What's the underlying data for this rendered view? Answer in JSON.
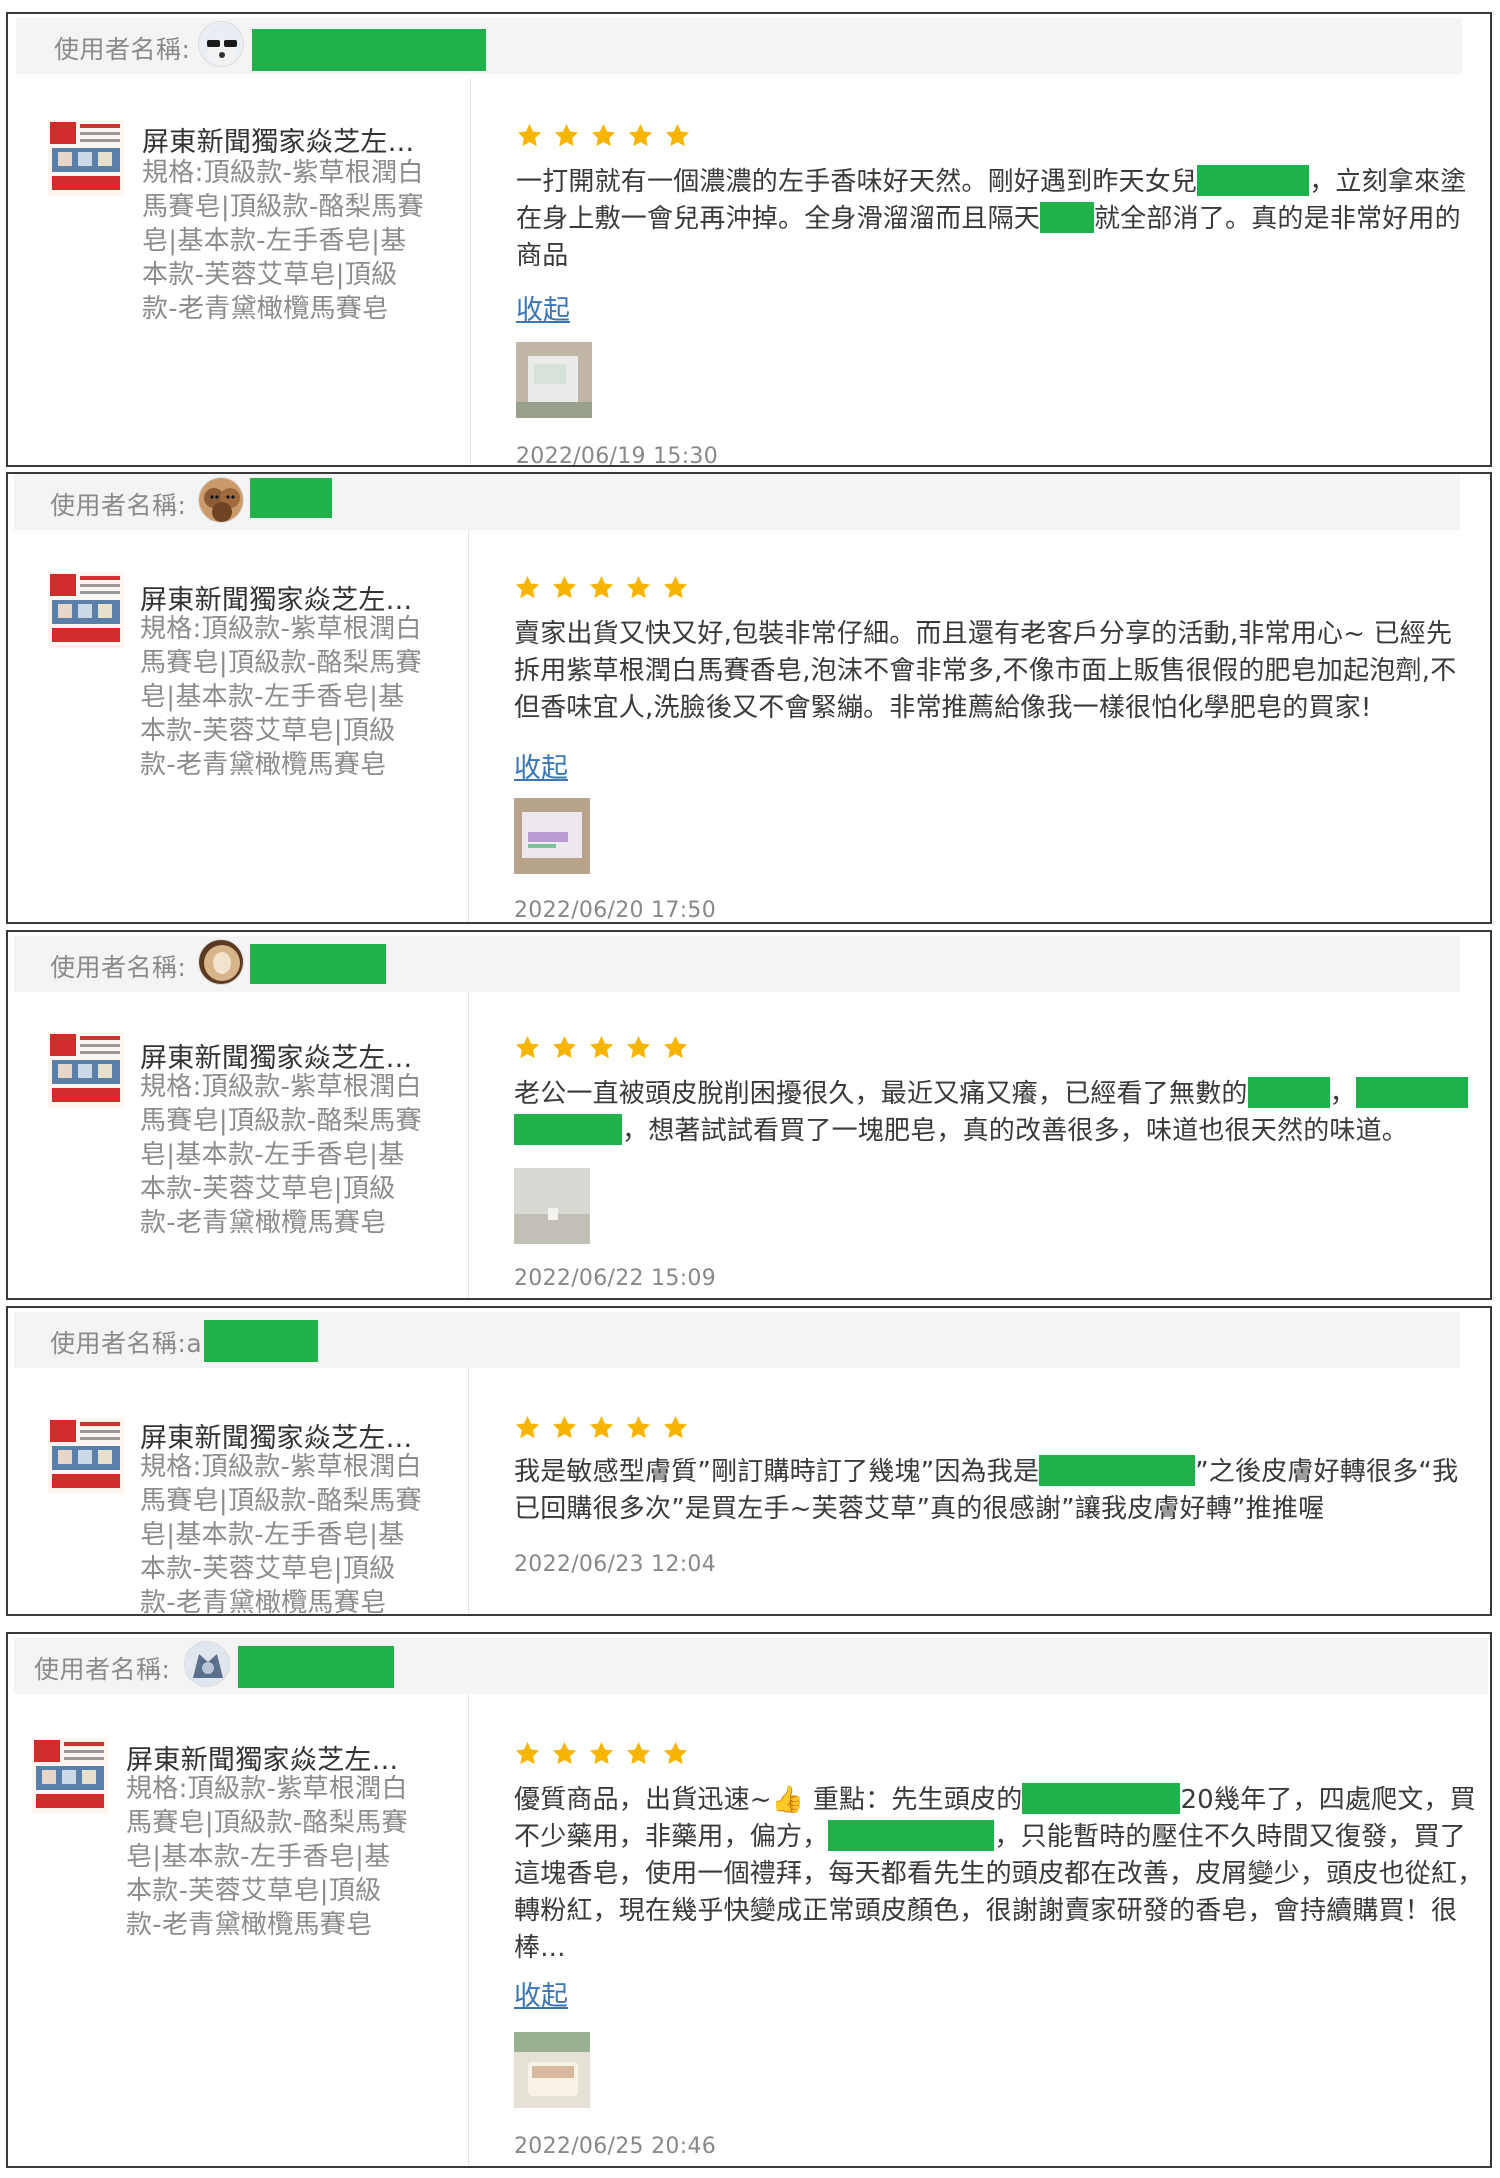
{
  "reviews": [
    {
      "username_label": "使用者名稱:",
      "product": {
        "name": "屏東新聞獨家焱芝左...",
        "spec": "規格:頂級款-紫草根潤白馬賽皂|頂級款-酪梨馬賽皂|基本款-左手香皂|基本款-芙蓉艾草皂|頂級款-老青黛橄欖馬賽皂"
      },
      "rating": 5,
      "text": {
        "p1": "一打開就有一個濃濃的左手香味好天然。剛好遇到昨天女兒",
        "p2": "，立刻拿來塗在身上敷一會兒再沖掉。全身滑溜溜而且隔天",
        "p3": "就全部消了。真的是非常好用的商品"
      },
      "collapse_label": "收起",
      "date": "2022/06/19 15:30"
    },
    {
      "username_label": "使用者名稱:",
      "product": {
        "name": "屏東新聞獨家焱芝左...",
        "spec": "規格:頂級款-紫草根潤白馬賽皂|頂級款-酪梨馬賽皂|基本款-左手香皂|基本款-芙蓉艾草皂|頂級款-老青黛橄欖馬賽皂"
      },
      "rating": 5,
      "text": {
        "p1": "賣家出貨又快又好,包裝非常仔細。而且還有老客戶分享的活動,非常用心~ 已經先拆用紫草根潤白馬賽香皂,泡沫不會非常多,不像市面上販售很假的肥皂加起泡劑,不但香味宜人,洗臉後又不會緊繃。非常推薦給像我一樣很怕化學肥皂的買家!"
      },
      "collapse_label": "收起",
      "date": "2022/06/20 17:50"
    },
    {
      "username_label": "使用者名稱:",
      "product": {
        "name": "屏東新聞獨家焱芝左...",
        "spec": "規格:頂級款-紫草根潤白馬賽皂|頂級款-酪梨馬賽皂|基本款-左手香皂|基本款-芙蓉艾草皂|頂級款-老青黛橄欖馬賽皂"
      },
      "rating": 5,
      "text": {
        "p1": "老公一直被頭皮脫削困擾很久，最近又痛又癢，已經看了無數的",
        "p2": "，",
        "p3": "，想著試試看買了一塊肥皂，真的改善很多，味道也很天然的味道。"
      },
      "date": "2022/06/22 15:09"
    },
    {
      "username_label": "使用者名稱:a",
      "product": {
        "name": "屏東新聞獨家焱芝左...",
        "spec": "規格:頂級款-紫草根潤白馬賽皂|頂級款-酪梨馬賽皂|基本款-左手香皂|基本款-芙蓉艾草皂|頂級款-老青黛橄欖馬賽皂"
      },
      "rating": 5,
      "text": {
        "p1": "我是敏感型膚質”剛訂購時訂了幾塊”因為我是",
        "p2": "”之後皮膚好轉很多“我已回購很多次”是買左手~芙蓉艾草”真的很感謝”讓我皮膚好轉”推推喔"
      },
      "date": "2022/06/23 12:04"
    },
    {
      "username_label": "使用者名稱:",
      "product": {
        "name": "屏東新聞獨家焱芝左...",
        "spec": "規格:頂級款-紫草根潤白馬賽皂|頂級款-酪梨馬賽皂|基本款-左手香皂|基本款-芙蓉艾草皂|頂級款-老青黛橄欖馬賽皂"
      },
      "rating": 5,
      "text": {
        "p1": "優質商品，出貨迅速~👍 重點：先生頭皮的",
        "p2": "20幾年了，四處爬文，買不少藥用，非藥用，偏方，",
        "p3": "，只能暫時的壓住不久時間又復發，買了這塊香皂，使用一個禮拜，每天都看先生的頭皮都在改善，皮屑變少，頭皮也從紅，轉粉紅，現在幾乎快變成正常頭皮顏色，很謝謝賣家研發的香皂，會持續購買！很棒..."
      },
      "collapse_label": "收起",
      "date": "2022/06/25 20:46"
    }
  ],
  "colors": {
    "star": "#f7b500",
    "redact": "#21b14c",
    "link": "#3a76b5"
  }
}
